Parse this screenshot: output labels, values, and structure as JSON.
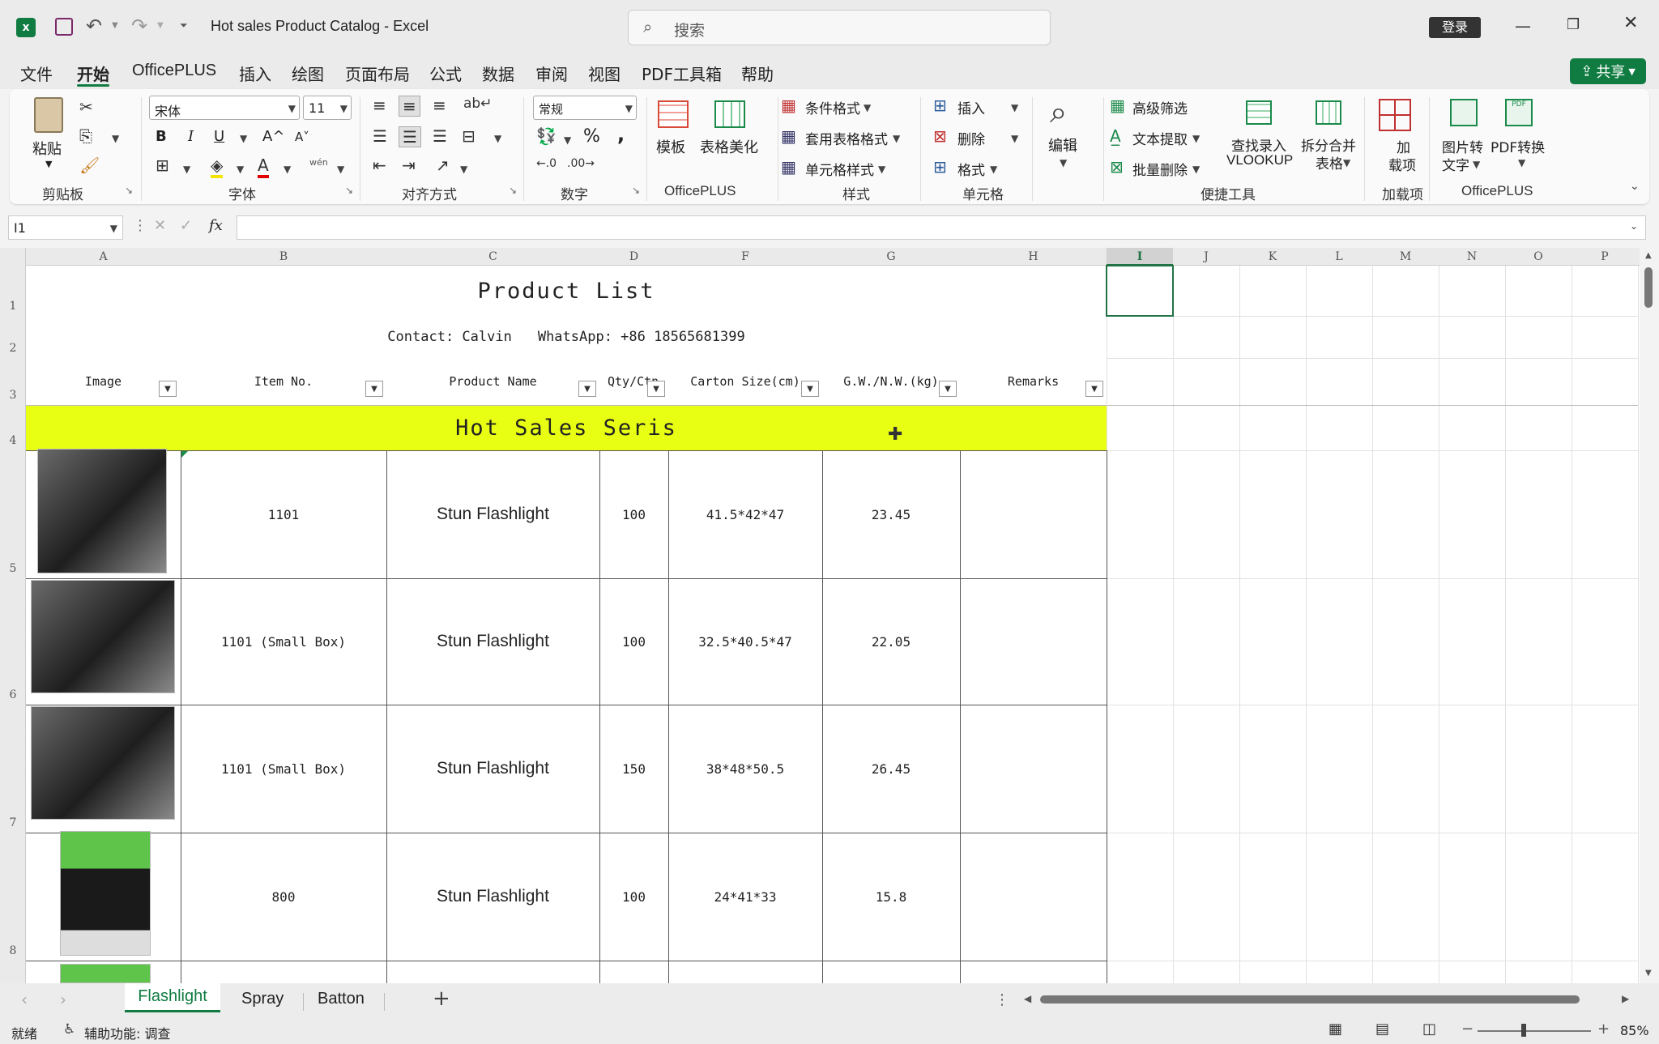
{
  "titlebar": {
    "app_icon": "excel-icon",
    "title": "Hot sales Product Catalog  -  Excel",
    "search_placeholder": "搜索",
    "login": "登录"
  },
  "menu": {
    "items": [
      "文件",
      "开始",
      "OfficePLUS",
      "插入",
      "绘图",
      "页面布局",
      "公式",
      "数据",
      "审阅",
      "视图",
      "PDF工具箱",
      "帮助"
    ],
    "active": "开始",
    "share": "共享"
  },
  "ribbon": {
    "clipboard": {
      "paste": "粘贴",
      "label": "剪贴板"
    },
    "font": {
      "name": "宋体",
      "size": "11",
      "label": "字体",
      "bold": "B",
      "italic": "I",
      "underline": "U",
      "grow": "A^",
      "shrink": "A˅",
      "pinyin": "wén"
    },
    "align": {
      "label": "对齐方式"
    },
    "number": {
      "format": "常规",
      "percent": "%",
      "comma": ",",
      "label": "数字"
    },
    "officeplus": {
      "template": "模板",
      "beautify": "表格美化",
      "label": "OfficePLUS"
    },
    "styles": {
      "cond": "条件格式",
      "table": "套用表格格式",
      "cell": "单元格样式",
      "label": "样式"
    },
    "cells": {
      "insert": "插入",
      "delete": "删除",
      "format": "格式",
      "label": "单元格"
    },
    "edit": {
      "label": "编辑"
    },
    "tools": {
      "adv_filter": "高级筛选",
      "text_extract": "文本提取",
      "batch_delete": "批量删除",
      "vlookup1": "查找录入",
      "vlookup2": "VLOOKUP",
      "split1": "拆分合并",
      "split2": "表格",
      "label": "便捷工具"
    },
    "addins": {
      "l1": "加",
      "l2": "载项",
      "label": "加载项"
    },
    "officeplus2": {
      "img1": "图片转",
      "img2": "文字",
      "pdf": "PDF转换",
      "label": "OfficePLUS"
    }
  },
  "formula_bar": {
    "name_box": "I1",
    "fx": "fx",
    "value": ""
  },
  "columns": [
    "A",
    "B",
    "C",
    "D",
    "F",
    "G",
    "H",
    "I",
    "J",
    "K",
    "L",
    "M",
    "N",
    "O",
    "P"
  ],
  "rows": [
    "1",
    "2",
    "3",
    "4",
    "5",
    "6",
    "7",
    "8"
  ],
  "sheet": {
    "title": "Product List",
    "contact": "Contact: Calvin",
    "whatsapp": "WhatsApp: +86 18565681399",
    "headers": [
      "Image",
      "Item No.",
      "Product Name",
      "Qty/Ctn",
      "Carton Size(cm)",
      "G.W./N.W.(kg)",
      "Remarks"
    ],
    "section": "Hot Sales Seris",
    "section_color": "#e8ff14",
    "products": [
      {
        "item": "1101",
        "name": "Stun Flashlight",
        "qty": "100",
        "carton": "41.5*42*47",
        "weight": "23.45",
        "remarks": ""
      },
      {
        "item": "1101 (Small Box)",
        "name": "Stun Flashlight",
        "qty": "100",
        "carton": "32.5*40.5*47",
        "weight": "22.05",
        "remarks": ""
      },
      {
        "item": "1101 (Small Box)",
        "name": "Stun Flashlight",
        "qty": "150",
        "carton": "38*48*50.5",
        "weight": "26.45",
        "remarks": ""
      },
      {
        "item": "800",
        "name": "Stun Flashlight",
        "qty": "100",
        "carton": "24*41*33",
        "weight": "15.8",
        "remarks": ""
      }
    ]
  },
  "sheet_tabs": {
    "tabs": [
      "Flashlight",
      "Spray",
      "Batton"
    ],
    "active": "Flashlight",
    "add": "+"
  },
  "status": {
    "ready": "就绪",
    "accessibility": "辅助功能: 调查",
    "zoom": "85%"
  },
  "colors": {
    "accent": "#107c41",
    "selection": "#217346",
    "section_fill": "#e8ff14"
  }
}
